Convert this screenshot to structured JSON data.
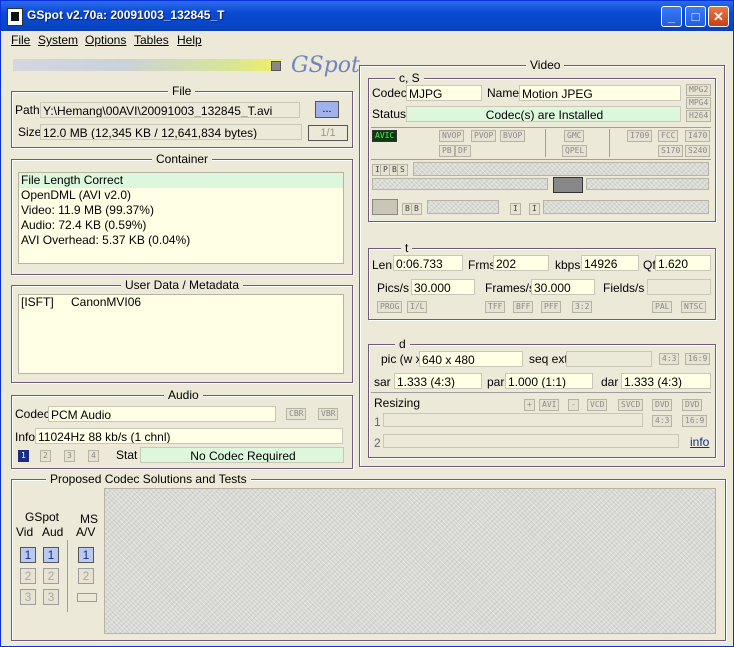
{
  "window": {
    "title": "GSpot v2.70a: 20091003_132845_T"
  },
  "menu": [
    "File",
    "System",
    "Options",
    "Tables",
    "Help"
  ],
  "logo_text": "GSpot",
  "file": {
    "title": "File",
    "path_label": "Path",
    "path_value": "Y:\\Hemang\\00AVI\\20091003_132845_T.avi",
    "browse_label": "...",
    "size_label": "Size",
    "size_value": "12.0 MB (12,345 KB / 12,641,834 bytes)",
    "count_label": "1/1"
  },
  "container": {
    "title": "Container",
    "lines": [
      "File Length Correct",
      "OpenDML (AVI v2.0)",
      "Video: 11.9 MB (99.37%)",
      "Audio: 72.4 KB (0.59%)",
      "AVI Overhead: 5.37 KB (0.04%)"
    ]
  },
  "userdata": {
    "title": "User Data / Metadata",
    "key": "[ISFT]",
    "value": "CanonMVI06"
  },
  "audio": {
    "title": "Audio",
    "codec_label": "Codec",
    "codec_value": "PCM Audio",
    "cbr": "CBR",
    "vbr": "VBR",
    "info_label": "Info",
    "info_value": "11024Hz  88 kb/s (1 chnl)",
    "tracks": [
      "1",
      "2",
      "3",
      "4"
    ],
    "stat_label": "Stat",
    "stat_value": "No Codec Required"
  },
  "proposed": {
    "title": "Proposed Codec Solutions and Tests",
    "gspot_label": "GSpot",
    "vid_label": "Vid",
    "aud_label": "Aud",
    "ms_label": "MS",
    "av_label": "A/V",
    "nums": [
      "1",
      "2",
      "3"
    ]
  },
  "video": {
    "title": "Video",
    "cs_title": "c, S",
    "codec_label": "Codec",
    "codec_value": "MJPG",
    "name_label": "Name",
    "name_value": "Motion JPEG",
    "status_label": "Status",
    "status_value": "Codec(s) are Installed",
    "mpg_tags": [
      "MPG2",
      "MPG4",
      "H264"
    ],
    "avic_tag": "AVIC",
    "tags_row1": [
      "NVOP",
      "PVOP",
      "BVOP"
    ],
    "tags_row2": [
      "PB",
      "DF"
    ],
    "gmc": "GMC",
    "qpel": "QPEL",
    "itu_tags_row1": [
      "I709",
      "FCC",
      "I470"
    ],
    "itu_tags_row2": [
      "S170",
      "S240"
    ],
    "frame_tags": [
      "I",
      "P",
      "B",
      "S"
    ],
    "bb_tags": [
      "B",
      "B"
    ],
    "ii_tags": [
      "I",
      "I"
    ],
    "t_title": "t",
    "len_label": "Len",
    "len_value": "0:06.733",
    "frms_label": "Frms",
    "frms_value": "202",
    "kbps_label": "kbps",
    "kbps_value": "14926",
    "qf_label": "Qf",
    "qf_value": "1.620",
    "pics_label": "Pics/s",
    "pics_value": "30.000",
    "frames_label": "Frames/s",
    "frames_value": "30.000",
    "fields_label": "Fields/s",
    "scan_tags": [
      "PROG",
      "I/L"
    ],
    "field_tags": [
      "TFF",
      "BFF",
      "PFF",
      "3:2"
    ],
    "pal": "PAL",
    "ntsc": "NTSC",
    "d_title": "d",
    "pic_label": "pic (w x h)",
    "pic_value": "640 x 480",
    "seqext_label": "seq ext",
    "ar43": "4:3",
    "ar169": "16:9",
    "sar_label": "sar",
    "sar_value": "1.333 (4:3)",
    "par_label": "par",
    "par_value": "1.000 (1:1)",
    "dar_label": "dar",
    "dar_value": "1.333 (4:3)",
    "resizing_label": "Resizing",
    "resize_tags": [
      "+",
      "AVI",
      "-",
      "VCD",
      "SVCD",
      "DVD",
      "DVD"
    ],
    "resize_ar": [
      "4:3",
      "16:9"
    ],
    "row1": "1",
    "row2": "2",
    "info_link": "info"
  }
}
